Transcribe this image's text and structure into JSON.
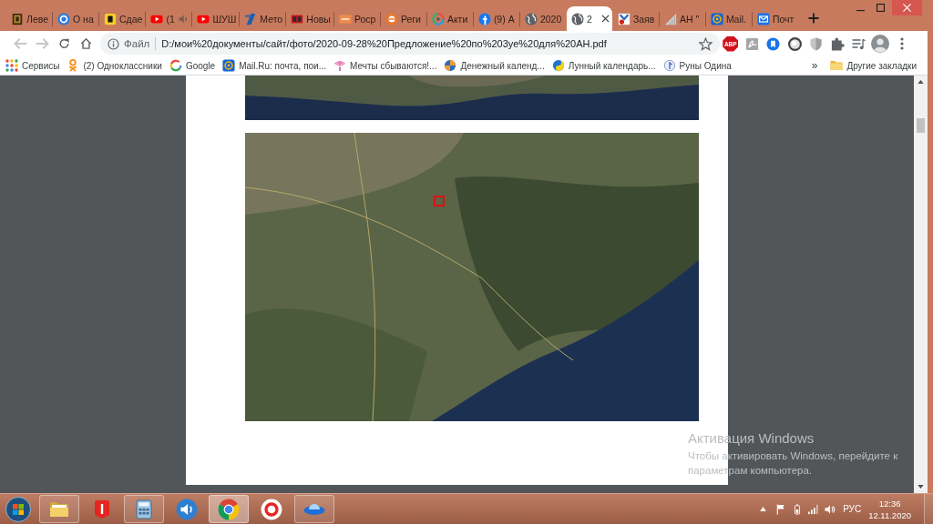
{
  "tabs": [
    {
      "kind": "book",
      "title": "Леве",
      "selected": false,
      "audio": false
    },
    {
      "kind": "ring",
      "title": "О на",
      "selected": false,
      "audio": false
    },
    {
      "kind": "yellow-tile",
      "title": "Сдае",
      "selected": false,
      "audio": false
    },
    {
      "kind": "play",
      "title": "(1",
      "selected": false,
      "audio": true
    },
    {
      "kind": "play",
      "title": "ШУШ",
      "selected": false,
      "audio": false
    },
    {
      "kind": "slash",
      "title": "Мето",
      "selected": false,
      "audio": false
    },
    {
      "kind": "red-tile",
      "title": "Новы",
      "selected": false,
      "audio": false
    },
    {
      "kind": "orange-tile",
      "title": "Роср",
      "selected": false,
      "audio": false
    },
    {
      "kind": "orange-disc",
      "title": "Реги",
      "selected": false,
      "audio": false
    },
    {
      "kind": "color-ring",
      "title": "Акти",
      "selected": false,
      "audio": false
    },
    {
      "kind": "blue-disc",
      "title": "(9) А",
      "selected": false,
      "audio": false
    },
    {
      "kind": "globe",
      "title": "2020",
      "selected": false,
      "audio": false
    },
    {
      "kind": "globe",
      "title": "2",
      "selected": true,
      "audio": false
    },
    {
      "kind": "chevron-tile",
      "title": "Заяв",
      "selected": false,
      "audio": false
    },
    {
      "kind": "triangle",
      "title": "АН \"",
      "selected": false,
      "audio": false
    },
    {
      "kind": "ring-tile",
      "title": "Mail.",
      "selected": false,
      "audio": false
    },
    {
      "kind": "envelope",
      "title": "Почт",
      "selected": false,
      "audio": false
    }
  ],
  "toolbar": {
    "back_disabled": true,
    "forward_disabled": true,
    "info_label": "Файл",
    "url": "D:/мои%20документы/сайт/фото/2020-09-28%20Предложение%20по%203уе%20для%20АН.pdf",
    "bookmarked": false,
    "extensions": [
      {
        "kind": "abp",
        "label": "ABP"
      },
      {
        "kind": "pdf"
      },
      {
        "kind": "bookmark"
      },
      {
        "kind": "circle"
      },
      {
        "kind": "shield"
      },
      {
        "kind": "puzzle"
      },
      {
        "kind": "media"
      }
    ]
  },
  "bookmarks": {
    "items": [
      {
        "kind": "apps",
        "label": "Сервисы"
      },
      {
        "kind": "person",
        "label": "(2) Одноклассники"
      },
      {
        "kind": "g-ring",
        "label": "Google"
      },
      {
        "kind": "ring-tile",
        "label": "Mail.Ru: почта, пои..."
      },
      {
        "kind": "fan",
        "label": "Мечты сбываются!..."
      },
      {
        "kind": "quarter-disc",
        "label": "Денежный календ..."
      },
      {
        "kind": "yin-yang",
        "label": "Лунный календарь..."
      },
      {
        "kind": "rune",
        "label": "Руны Одина"
      }
    ],
    "overflow": "»",
    "other": "Другие закладки"
  },
  "activation": {
    "title": "Активация Windows",
    "text": "Чтобы активировать Windows, перейдите к параметрам компьютера."
  },
  "taskbar": {
    "apps": [
      {
        "kind": "folder",
        "running": true,
        "selected": false
      },
      {
        "kind": "yandex",
        "running": false,
        "selected": false
      },
      {
        "kind": "calculator",
        "running": true,
        "selected": false
      },
      {
        "kind": "speaker",
        "running": false,
        "selected": false
      },
      {
        "kind": "chrome",
        "running": true,
        "selected": true
      },
      {
        "kind": "y-browser",
        "running": false,
        "selected": false
      },
      {
        "kind": "saucer",
        "running": true,
        "selected": false
      }
    ],
    "language": "РУС",
    "time": "12:36",
    "date": "12.11.2020"
  }
}
